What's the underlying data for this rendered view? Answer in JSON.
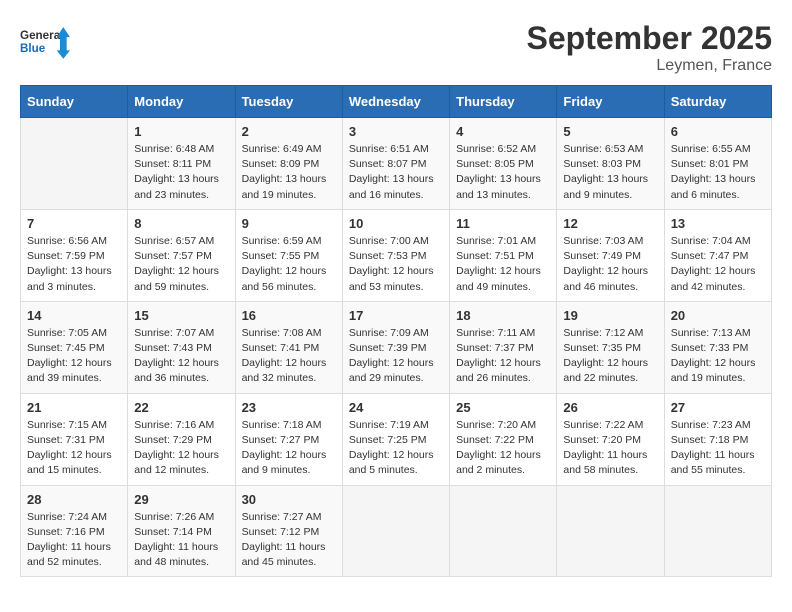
{
  "header": {
    "logo_line1": "General",
    "logo_line2": "Blue",
    "month": "September 2025",
    "location": "Leymen, France"
  },
  "days_of_week": [
    "Sunday",
    "Monday",
    "Tuesday",
    "Wednesday",
    "Thursday",
    "Friday",
    "Saturday"
  ],
  "weeks": [
    [
      {
        "day": "",
        "info": ""
      },
      {
        "day": "1",
        "info": "Sunrise: 6:48 AM\nSunset: 8:11 PM\nDaylight: 13 hours\nand 23 minutes."
      },
      {
        "day": "2",
        "info": "Sunrise: 6:49 AM\nSunset: 8:09 PM\nDaylight: 13 hours\nand 19 minutes."
      },
      {
        "day": "3",
        "info": "Sunrise: 6:51 AM\nSunset: 8:07 PM\nDaylight: 13 hours\nand 16 minutes."
      },
      {
        "day": "4",
        "info": "Sunrise: 6:52 AM\nSunset: 8:05 PM\nDaylight: 13 hours\nand 13 minutes."
      },
      {
        "day": "5",
        "info": "Sunrise: 6:53 AM\nSunset: 8:03 PM\nDaylight: 13 hours\nand 9 minutes."
      },
      {
        "day": "6",
        "info": "Sunrise: 6:55 AM\nSunset: 8:01 PM\nDaylight: 13 hours\nand 6 minutes."
      }
    ],
    [
      {
        "day": "7",
        "info": "Sunrise: 6:56 AM\nSunset: 7:59 PM\nDaylight: 13 hours\nand 3 minutes."
      },
      {
        "day": "8",
        "info": "Sunrise: 6:57 AM\nSunset: 7:57 PM\nDaylight: 12 hours\nand 59 minutes."
      },
      {
        "day": "9",
        "info": "Sunrise: 6:59 AM\nSunset: 7:55 PM\nDaylight: 12 hours\nand 56 minutes."
      },
      {
        "day": "10",
        "info": "Sunrise: 7:00 AM\nSunset: 7:53 PM\nDaylight: 12 hours\nand 53 minutes."
      },
      {
        "day": "11",
        "info": "Sunrise: 7:01 AM\nSunset: 7:51 PM\nDaylight: 12 hours\nand 49 minutes."
      },
      {
        "day": "12",
        "info": "Sunrise: 7:03 AM\nSunset: 7:49 PM\nDaylight: 12 hours\nand 46 minutes."
      },
      {
        "day": "13",
        "info": "Sunrise: 7:04 AM\nSunset: 7:47 PM\nDaylight: 12 hours\nand 42 minutes."
      }
    ],
    [
      {
        "day": "14",
        "info": "Sunrise: 7:05 AM\nSunset: 7:45 PM\nDaylight: 12 hours\nand 39 minutes."
      },
      {
        "day": "15",
        "info": "Sunrise: 7:07 AM\nSunset: 7:43 PM\nDaylight: 12 hours\nand 36 minutes."
      },
      {
        "day": "16",
        "info": "Sunrise: 7:08 AM\nSunset: 7:41 PM\nDaylight: 12 hours\nand 32 minutes."
      },
      {
        "day": "17",
        "info": "Sunrise: 7:09 AM\nSunset: 7:39 PM\nDaylight: 12 hours\nand 29 minutes."
      },
      {
        "day": "18",
        "info": "Sunrise: 7:11 AM\nSunset: 7:37 PM\nDaylight: 12 hours\nand 26 minutes."
      },
      {
        "day": "19",
        "info": "Sunrise: 7:12 AM\nSunset: 7:35 PM\nDaylight: 12 hours\nand 22 minutes."
      },
      {
        "day": "20",
        "info": "Sunrise: 7:13 AM\nSunset: 7:33 PM\nDaylight: 12 hours\nand 19 minutes."
      }
    ],
    [
      {
        "day": "21",
        "info": "Sunrise: 7:15 AM\nSunset: 7:31 PM\nDaylight: 12 hours\nand 15 minutes."
      },
      {
        "day": "22",
        "info": "Sunrise: 7:16 AM\nSunset: 7:29 PM\nDaylight: 12 hours\nand 12 minutes."
      },
      {
        "day": "23",
        "info": "Sunrise: 7:18 AM\nSunset: 7:27 PM\nDaylight: 12 hours\nand 9 minutes."
      },
      {
        "day": "24",
        "info": "Sunrise: 7:19 AM\nSunset: 7:25 PM\nDaylight: 12 hours\nand 5 minutes."
      },
      {
        "day": "25",
        "info": "Sunrise: 7:20 AM\nSunset: 7:22 PM\nDaylight: 12 hours\nand 2 minutes."
      },
      {
        "day": "26",
        "info": "Sunrise: 7:22 AM\nSunset: 7:20 PM\nDaylight: 11 hours\nand 58 minutes."
      },
      {
        "day": "27",
        "info": "Sunrise: 7:23 AM\nSunset: 7:18 PM\nDaylight: 11 hours\nand 55 minutes."
      }
    ],
    [
      {
        "day": "28",
        "info": "Sunrise: 7:24 AM\nSunset: 7:16 PM\nDaylight: 11 hours\nand 52 minutes."
      },
      {
        "day": "29",
        "info": "Sunrise: 7:26 AM\nSunset: 7:14 PM\nDaylight: 11 hours\nand 48 minutes."
      },
      {
        "day": "30",
        "info": "Sunrise: 7:27 AM\nSunset: 7:12 PM\nDaylight: 11 hours\nand 45 minutes."
      },
      {
        "day": "",
        "info": ""
      },
      {
        "day": "",
        "info": ""
      },
      {
        "day": "",
        "info": ""
      },
      {
        "day": "",
        "info": ""
      }
    ]
  ]
}
